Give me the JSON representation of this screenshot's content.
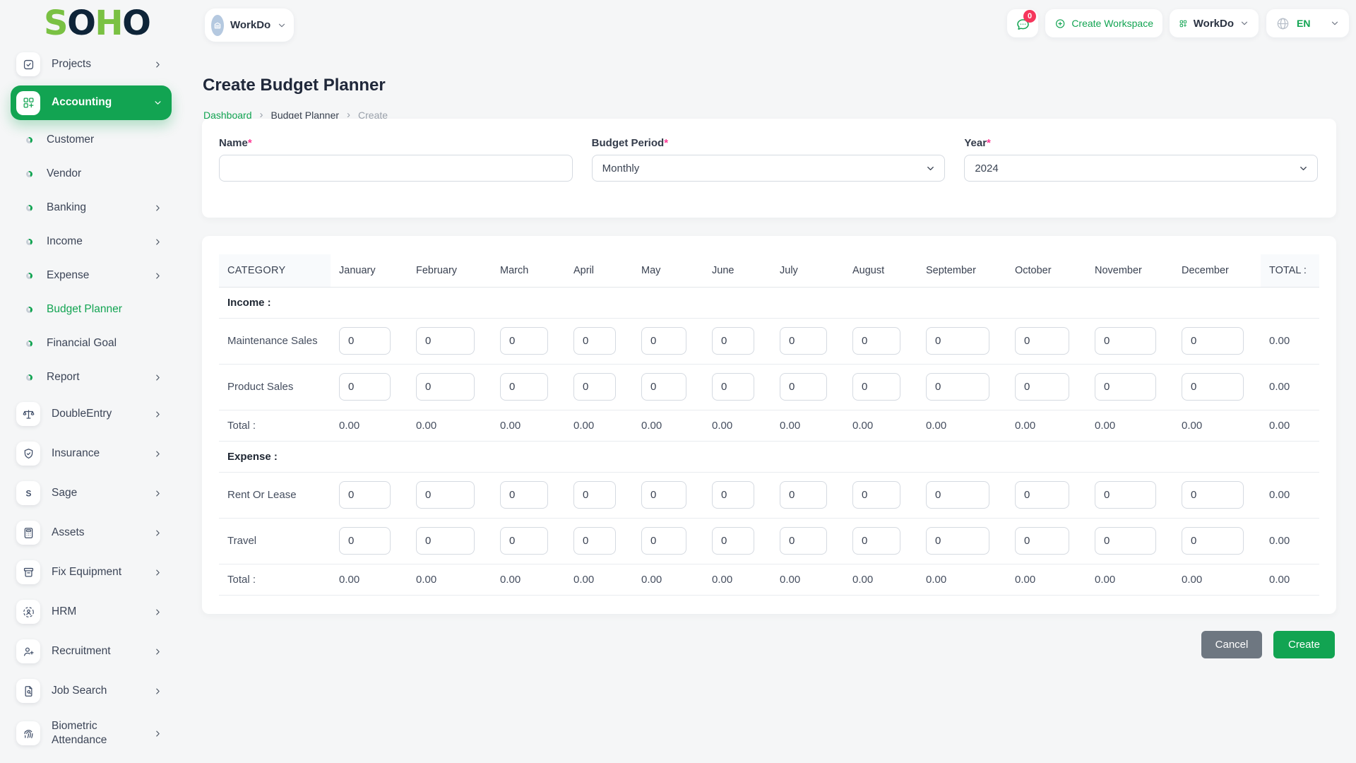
{
  "logo": {
    "letters": [
      "S",
      "O",
      "H",
      "O"
    ]
  },
  "topbar": {
    "workspace_switcher": {
      "label": "WorkDo"
    },
    "messages": {
      "badge_count": "0"
    },
    "create_workspace_label": "Create Workspace",
    "app_menu_label": "WorkDo",
    "language_label": "EN"
  },
  "page": {
    "title": "Create Budget Planner",
    "breadcrumb": [
      "Dashboard",
      "Budget Planner",
      "Create"
    ]
  },
  "sidebar": {
    "items": [
      {
        "label": "Projects",
        "icon": "tasks-icon",
        "kind": "main",
        "has_children": true,
        "first": true
      },
      {
        "label": "Accounting",
        "icon": "accounting-grid-icon",
        "kind": "main",
        "has_children": true,
        "active": true,
        "expanded": true
      },
      {
        "label": "Customer",
        "kind": "sub"
      },
      {
        "label": "Vendor",
        "kind": "sub"
      },
      {
        "label": "Banking",
        "kind": "sub",
        "has_children": true
      },
      {
        "label": "Income",
        "kind": "sub",
        "has_children": true
      },
      {
        "label": "Expense",
        "kind": "sub",
        "has_children": true
      },
      {
        "label": "Budget Planner",
        "kind": "sub",
        "active": true
      },
      {
        "label": "Financial Goal",
        "kind": "sub"
      },
      {
        "label": "Report",
        "kind": "sub",
        "has_children": true
      },
      {
        "label": "DoubleEntry",
        "icon": "scale-icon",
        "kind": "main",
        "has_children": true
      },
      {
        "label": "Insurance",
        "icon": "shield-check-icon",
        "kind": "main",
        "has_children": true
      },
      {
        "label": "Sage",
        "icon": "sage-s-icon",
        "kind": "main",
        "has_children": true
      },
      {
        "label": "Assets",
        "icon": "calculator-icon",
        "kind": "main",
        "has_children": true
      },
      {
        "label": "Fix Equipment",
        "icon": "archive-box-icon",
        "kind": "main",
        "has_children": true
      },
      {
        "label": "HRM",
        "icon": "person-scan-icon",
        "kind": "main",
        "has_children": true
      },
      {
        "label": "Recruitment",
        "icon": "user-plus-icon",
        "kind": "main",
        "has_children": true
      },
      {
        "label": "Job Search",
        "icon": "document-search-icon",
        "kind": "main",
        "has_children": true
      },
      {
        "label": "Biometric Attendance",
        "icon": "fingerprint-icon",
        "kind": "main",
        "has_children": true,
        "tall": true
      }
    ]
  },
  "form": {
    "name": {
      "label": "Name",
      "required": "*",
      "value": ""
    },
    "budget_period": {
      "label": "Budget Period",
      "required": "*",
      "value": "Monthly"
    },
    "year": {
      "label": "Year",
      "required": "*",
      "value": "2024"
    }
  },
  "table": {
    "category_header": "CATEGORY",
    "months": [
      "January",
      "February",
      "March",
      "April",
      "May",
      "June",
      "July",
      "August",
      "September",
      "October",
      "November",
      "December"
    ],
    "total_header": "TOTAL :",
    "sections": [
      {
        "label": "Income :",
        "rows": [
          {
            "label": "Maintenance Sales",
            "values": [
              "0",
              "0",
              "0",
              "0",
              "0",
              "0",
              "0",
              "0",
              "0",
              "0",
              "0",
              "0"
            ],
            "row_total": "0.00"
          },
          {
            "label": "Product Sales",
            "values": [
              "0",
              "0",
              "0",
              "0",
              "0",
              "0",
              "0",
              "0",
              "0",
              "0",
              "0",
              "0"
            ],
            "row_total": "0.00"
          }
        ],
        "total_label": "Total :",
        "monthly_totals": [
          "0.00",
          "0.00",
          "0.00",
          "0.00",
          "0.00",
          "0.00",
          "0.00",
          "0.00",
          "0.00",
          "0.00",
          "0.00",
          "0.00"
        ],
        "grand_total": "0.00"
      },
      {
        "label": "Expense :",
        "rows": [
          {
            "label": "Rent Or Lease",
            "values": [
              "0",
              "0",
              "0",
              "0",
              "0",
              "0",
              "0",
              "0",
              "0",
              "0",
              "0",
              "0"
            ],
            "row_total": "0.00"
          },
          {
            "label": "Travel",
            "values": [
              "0",
              "0",
              "0",
              "0",
              "0",
              "0",
              "0",
              "0",
              "0",
              "0",
              "0",
              "0"
            ],
            "row_total": "0.00"
          }
        ],
        "total_label": "Total :",
        "monthly_totals": [
          "0.00",
          "0.00",
          "0.00",
          "0.00",
          "0.00",
          "0.00",
          "0.00",
          "0.00",
          "0.00",
          "0.00",
          "0.00",
          "0.00"
        ],
        "grand_total": "0.00"
      }
    ]
  },
  "actions": {
    "cancel_label": "Cancel",
    "create_label": "Create"
  },
  "colors": {
    "primary_green": "#12a452",
    "logo_green": "#7ac143",
    "logo_navy": "#0e2438",
    "badge_red": "#f5365c",
    "required_pink": "#fd3995",
    "cancel_gray": "#6e7781"
  }
}
